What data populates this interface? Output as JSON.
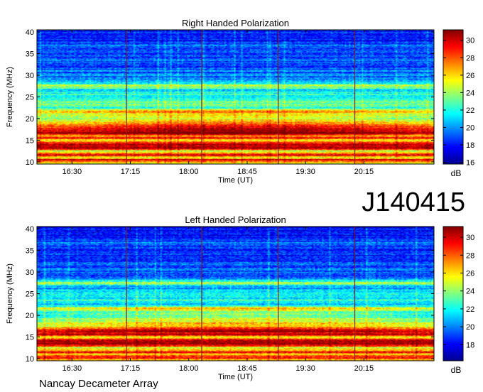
{
  "chart_data": [
    {
      "type": "heatmap",
      "title": "Right Handed Polarization",
      "xlabel": "Time (UT)",
      "ylabel": "Frequency (MHz)",
      "x_ticks": [
        "16:30",
        "17:15",
        "18:00",
        "18:45",
        "19:30",
        "20:15"
      ],
      "x_range": [
        "16:03",
        "21:09"
      ],
      "y_ticks": [
        10,
        15,
        20,
        25,
        30,
        35,
        40
      ],
      "ylim": [
        9.5,
        40.5
      ],
      "colorbar": {
        "label": "dB",
        "ticks": [
          16,
          18,
          20,
          22,
          24,
          26,
          28,
          30
        ],
        "range": [
          15.8,
          31.2
        ]
      },
      "colormap": [
        "#00008f",
        "#0000ff",
        "#0080ff",
        "#00ffff",
        "#80ff80",
        "#ffff00",
        "#ff8000",
        "#ff0000",
        "#800000"
      ],
      "markers_time": [
        "17:12",
        "18:10",
        "19:09",
        "20:08"
      ],
      "marker_color": "#8b1a1a",
      "band_profile_db": [
        [
          9.5,
          24.5
        ],
        [
          10.5,
          30.5
        ],
        [
          11.0,
          24.0
        ],
        [
          11.5,
          29.5
        ],
        [
          12.5,
          24.5
        ],
        [
          13.0,
          30.0
        ],
        [
          14.0,
          30.5
        ],
        [
          15.0,
          25.0
        ],
        [
          15.5,
          30.5
        ],
        [
          16.0,
          26.0
        ],
        [
          16.5,
          30.0
        ],
        [
          17.5,
          28.5
        ],
        [
          18.5,
          27.0
        ],
        [
          19.5,
          24.5
        ],
        [
          20.5,
          23.0
        ],
        [
          21.5,
          25.5
        ],
        [
          22.5,
          22.0
        ],
        [
          23.5,
          23.5
        ],
        [
          24.5,
          22.0
        ],
        [
          25.5,
          22.5
        ],
        [
          26.5,
          21.0
        ],
        [
          27.5,
          25.0
        ],
        [
          28.5,
          20.0
        ],
        [
          30.0,
          19.5
        ],
        [
          32.5,
          19.0
        ],
        [
          35.0,
          18.5
        ],
        [
          36.5,
          19.5
        ],
        [
          38.0,
          18.0
        ],
        [
          39.5,
          18.5
        ],
        [
          40.5,
          17.5
        ]
      ]
    },
    {
      "type": "heatmap",
      "title": "Left Handed Polarization",
      "xlabel": "Time (UT)",
      "ylabel": "Frequency (MHz)",
      "x_ticks": [
        "16:30",
        "17:15",
        "18:00",
        "18:45",
        "19:30",
        "20:15"
      ],
      "x_range": [
        "16:03",
        "21:09"
      ],
      "y_ticks": [
        10,
        15,
        20,
        25,
        30,
        35,
        40
      ],
      "ylim": [
        9.5,
        40.5
      ],
      "colorbar": {
        "label": "dB",
        "ticks": [
          18,
          20,
          22,
          24,
          26,
          28,
          30
        ],
        "range": [
          16.2,
          31.2
        ]
      },
      "colormap": [
        "#00008f",
        "#0000ff",
        "#0080ff",
        "#00ffff",
        "#80ff80",
        "#ffff00",
        "#ff8000",
        "#ff0000",
        "#800000"
      ],
      "markers_time": [
        "17:12",
        "18:10",
        "19:09",
        "20:08"
      ],
      "marker_color": "#8b1a1a",
      "band_profile_db": [
        [
          9.5,
          25.0
        ],
        [
          10.5,
          30.0
        ],
        [
          11.0,
          24.5
        ],
        [
          11.5,
          29.5
        ],
        [
          12.5,
          24.0
        ],
        [
          13.0,
          30.0
        ],
        [
          14.0,
          30.5
        ],
        [
          15.0,
          25.5
        ],
        [
          15.5,
          30.0
        ],
        [
          16.5,
          29.0
        ],
        [
          17.5,
          25.0
        ],
        [
          18.5,
          24.0
        ],
        [
          19.5,
          22.5
        ],
        [
          20.5,
          21.5
        ],
        [
          21.5,
          24.5
        ],
        [
          22.5,
          21.0
        ],
        [
          23.5,
          22.5
        ],
        [
          24.5,
          21.0
        ],
        [
          25.5,
          22.0
        ],
        [
          26.5,
          20.5
        ],
        [
          27.5,
          24.5
        ],
        [
          28.5,
          20.0
        ],
        [
          30.0,
          19.5
        ],
        [
          32.5,
          19.0
        ],
        [
          35.0,
          18.5
        ],
        [
          36.5,
          19.5
        ],
        [
          38.0,
          18.0
        ],
        [
          39.5,
          18.5
        ],
        [
          40.5,
          17.5
        ]
      ]
    }
  ],
  "label": "J140415",
  "footer": "Nancay Decameter Array"
}
